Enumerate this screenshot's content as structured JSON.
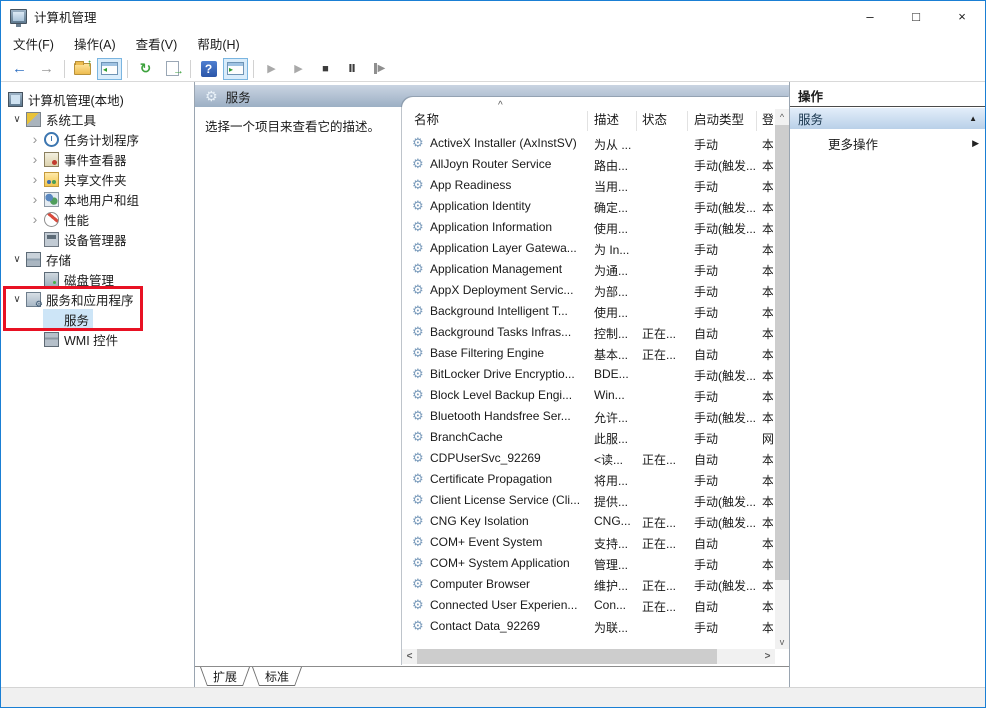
{
  "window": {
    "title": "计算机管理",
    "minimize": "–",
    "maximize": "□",
    "close": "×"
  },
  "menu": {
    "items": [
      {
        "label": "文件(F)"
      },
      {
        "label": "操作(A)"
      },
      {
        "label": "查看(V)"
      },
      {
        "label": "帮助(H)"
      }
    ]
  },
  "toolbar": {
    "back": "←",
    "forward": "→",
    "folder_up": "↑",
    "tree_toggle_mini": "◂",
    "refresh": "↻",
    "export_arrow": "→",
    "help": "?",
    "action_toggle_mini": "▸",
    "start": "▶",
    "resume": "▶",
    "stop": "■",
    "pause": "Ⅱ",
    "restart": "▶"
  },
  "tree": {
    "items": [
      {
        "label": "计算机管理(本地)",
        "indent": 6,
        "expGlyph": "",
        "expClass": "",
        "iconClass": "ti-computer",
        "icon": "computer-icon",
        "selClass": "",
        "rootClass": "noexp"
      },
      {
        "label": "系统工具",
        "indent": 8,
        "expGlyph": "∨",
        "expClass": "exp-open",
        "iconClass": "ti-tools",
        "icon": "system-tools-icon",
        "selClass": ""
      },
      {
        "label": "任务计划程序",
        "indent": 26,
        "expGlyph": "›",
        "expClass": "exp-closed",
        "iconClass": "ti-clock",
        "icon": "task-scheduler-icon",
        "selClass": ""
      },
      {
        "label": "事件查看器",
        "indent": 26,
        "expGlyph": "›",
        "expClass": "exp-closed",
        "iconClass": "ti-book",
        "icon": "event-viewer-icon",
        "selClass": ""
      },
      {
        "label": "共享文件夹",
        "indent": 26,
        "expGlyph": "›",
        "expClass": "exp-closed",
        "iconClass": "ti-sharedfolder",
        "icon": "shared-folders-icon",
        "selClass": ""
      },
      {
        "label": "本地用户和组",
        "indent": 26,
        "expGlyph": "›",
        "expClass": "exp-closed",
        "iconClass": "ti-users",
        "icon": "local-users-groups-icon",
        "selClass": ""
      },
      {
        "label": "性能",
        "indent": 26,
        "expGlyph": "›",
        "expClass": "exp-closed",
        "iconClass": "ti-gauge",
        "icon": "performance-icon",
        "selClass": ""
      },
      {
        "label": "设备管理器",
        "indent": 42,
        "expGlyph": "",
        "expClass": "",
        "iconClass": "ti-device",
        "icon": "device-manager-icon",
        "selClass": "",
        "rootClass": "noexp"
      },
      {
        "label": "存储",
        "indent": 8,
        "expGlyph": "∨",
        "expClass": "exp-open",
        "iconClass": "ti-storage",
        "icon": "storage-icon",
        "selClass": ""
      },
      {
        "label": "磁盘管理",
        "indent": 42,
        "expGlyph": "",
        "expClass": "",
        "iconClass": "ti-disk",
        "icon": "disk-management-icon",
        "selClass": "",
        "rootClass": "noexp"
      },
      {
        "label": "服务和应用程序",
        "indent": 8,
        "expGlyph": "∨",
        "expClass": "exp-open",
        "iconClass": "ti-srvapps",
        "icon": "services-applications-icon",
        "selClass": ""
      },
      {
        "label": "服务",
        "indent": 42,
        "expGlyph": "",
        "expClass": "",
        "iconClass": "ti-gear",
        "icon": "services-icon",
        "selClass": "sel",
        "rootClass": "noexp"
      },
      {
        "label": "WMI 控件",
        "indent": 42,
        "expGlyph": "",
        "expClass": "",
        "iconClass": "ti-wmi",
        "icon": "wmi-control-icon",
        "selClass": "",
        "rootClass": "noexp"
      }
    ]
  },
  "services_view": {
    "banner_title": "服务",
    "description_hint": "选择一个项目来查看它的描述。",
    "sort_caret": "^",
    "columns": {
      "name": "名称",
      "description": "描述",
      "status": "状态",
      "startup": "启动类型",
      "logon": "登"
    },
    "rows": [
      {
        "name": "ActiveX Installer (AxInstSV)",
        "desc": "为从 ...",
        "status": "",
        "startup": "手动",
        "logon": "本"
      },
      {
        "name": "AllJoyn Router Service",
        "desc": "路由...",
        "status": "",
        "startup": "手动(触发...",
        "logon": "本"
      },
      {
        "name": "App Readiness",
        "desc": "当用...",
        "status": "",
        "startup": "手动",
        "logon": "本"
      },
      {
        "name": "Application Identity",
        "desc": "确定...",
        "status": "",
        "startup": "手动(触发...",
        "logon": "本"
      },
      {
        "name": "Application Information",
        "desc": "使用...",
        "status": "",
        "startup": "手动(触发...",
        "logon": "本"
      },
      {
        "name": "Application Layer Gatewa...",
        "desc": "为 In...",
        "status": "",
        "startup": "手动",
        "logon": "本"
      },
      {
        "name": "Application Management",
        "desc": "为通...",
        "status": "",
        "startup": "手动",
        "logon": "本"
      },
      {
        "name": "AppX Deployment Servic...",
        "desc": "为部...",
        "status": "",
        "startup": "手动",
        "logon": "本"
      },
      {
        "name": "Background Intelligent T...",
        "desc": "使用...",
        "status": "",
        "startup": "手动",
        "logon": "本"
      },
      {
        "name": "Background Tasks Infras...",
        "desc": "控制...",
        "status": "正在...",
        "startup": "自动",
        "logon": "本"
      },
      {
        "name": "Base Filtering Engine",
        "desc": "基本...",
        "status": "正在...",
        "startup": "自动",
        "logon": "本"
      },
      {
        "name": "BitLocker Drive Encryptio...",
        "desc": "BDE...",
        "status": "",
        "startup": "手动(触发...",
        "logon": "本"
      },
      {
        "name": "Block Level Backup Engi...",
        "desc": "Win...",
        "status": "",
        "startup": "手动",
        "logon": "本"
      },
      {
        "name": "Bluetooth Handsfree Ser...",
        "desc": "允许...",
        "status": "",
        "startup": "手动(触发...",
        "logon": "本"
      },
      {
        "name": "BranchCache",
        "desc": "此服...",
        "status": "",
        "startup": "手动",
        "logon": "网"
      },
      {
        "name": "CDPUserSvc_92269",
        "desc": "<读...",
        "status": "正在...",
        "startup": "自动",
        "logon": "本"
      },
      {
        "name": "Certificate Propagation",
        "desc": "将用...",
        "status": "",
        "startup": "手动",
        "logon": "本"
      },
      {
        "name": "Client License Service (Cli...",
        "desc": "提供...",
        "status": "",
        "startup": "手动(触发...",
        "logon": "本"
      },
      {
        "name": "CNG Key Isolation",
        "desc": "CNG...",
        "status": "正在...",
        "startup": "手动(触发...",
        "logon": "本"
      },
      {
        "name": "COM+ Event System",
        "desc": "支持...",
        "status": "正在...",
        "startup": "自动",
        "logon": "本"
      },
      {
        "name": "COM+ System Application",
        "desc": "管理...",
        "status": "",
        "startup": "手动",
        "logon": "本"
      },
      {
        "name": "Computer Browser",
        "desc": "维护...",
        "status": "正在...",
        "startup": "手动(触发...",
        "logon": "本"
      },
      {
        "name": "Connected User Experien...",
        "desc": "Con...",
        "status": "正在...",
        "startup": "自动",
        "logon": "本"
      },
      {
        "name": "Contact Data_92269",
        "desc": "为联...",
        "status": "",
        "startup": "手动",
        "logon": "本"
      }
    ],
    "scroll": {
      "up": "^",
      "down": "v",
      "left": "<",
      "right": ">"
    }
  },
  "actions_pane": {
    "header": "操作",
    "group_title": "服务",
    "collapse_caret": "▲",
    "more_actions": "更多操作",
    "more_arrow": "▶"
  },
  "tabs": {
    "items": [
      {
        "label": "扩展"
      },
      {
        "label": "标准"
      }
    ]
  },
  "colors": {
    "accent_border": "#1a7fd4",
    "banner_from": "#c9d4e2",
    "banner_to": "#9cafc4",
    "selection": "#cde5f7",
    "annotation": "#e81123",
    "action_group_from": "#e3eefa",
    "action_group_to": "#b9d0e8"
  }
}
